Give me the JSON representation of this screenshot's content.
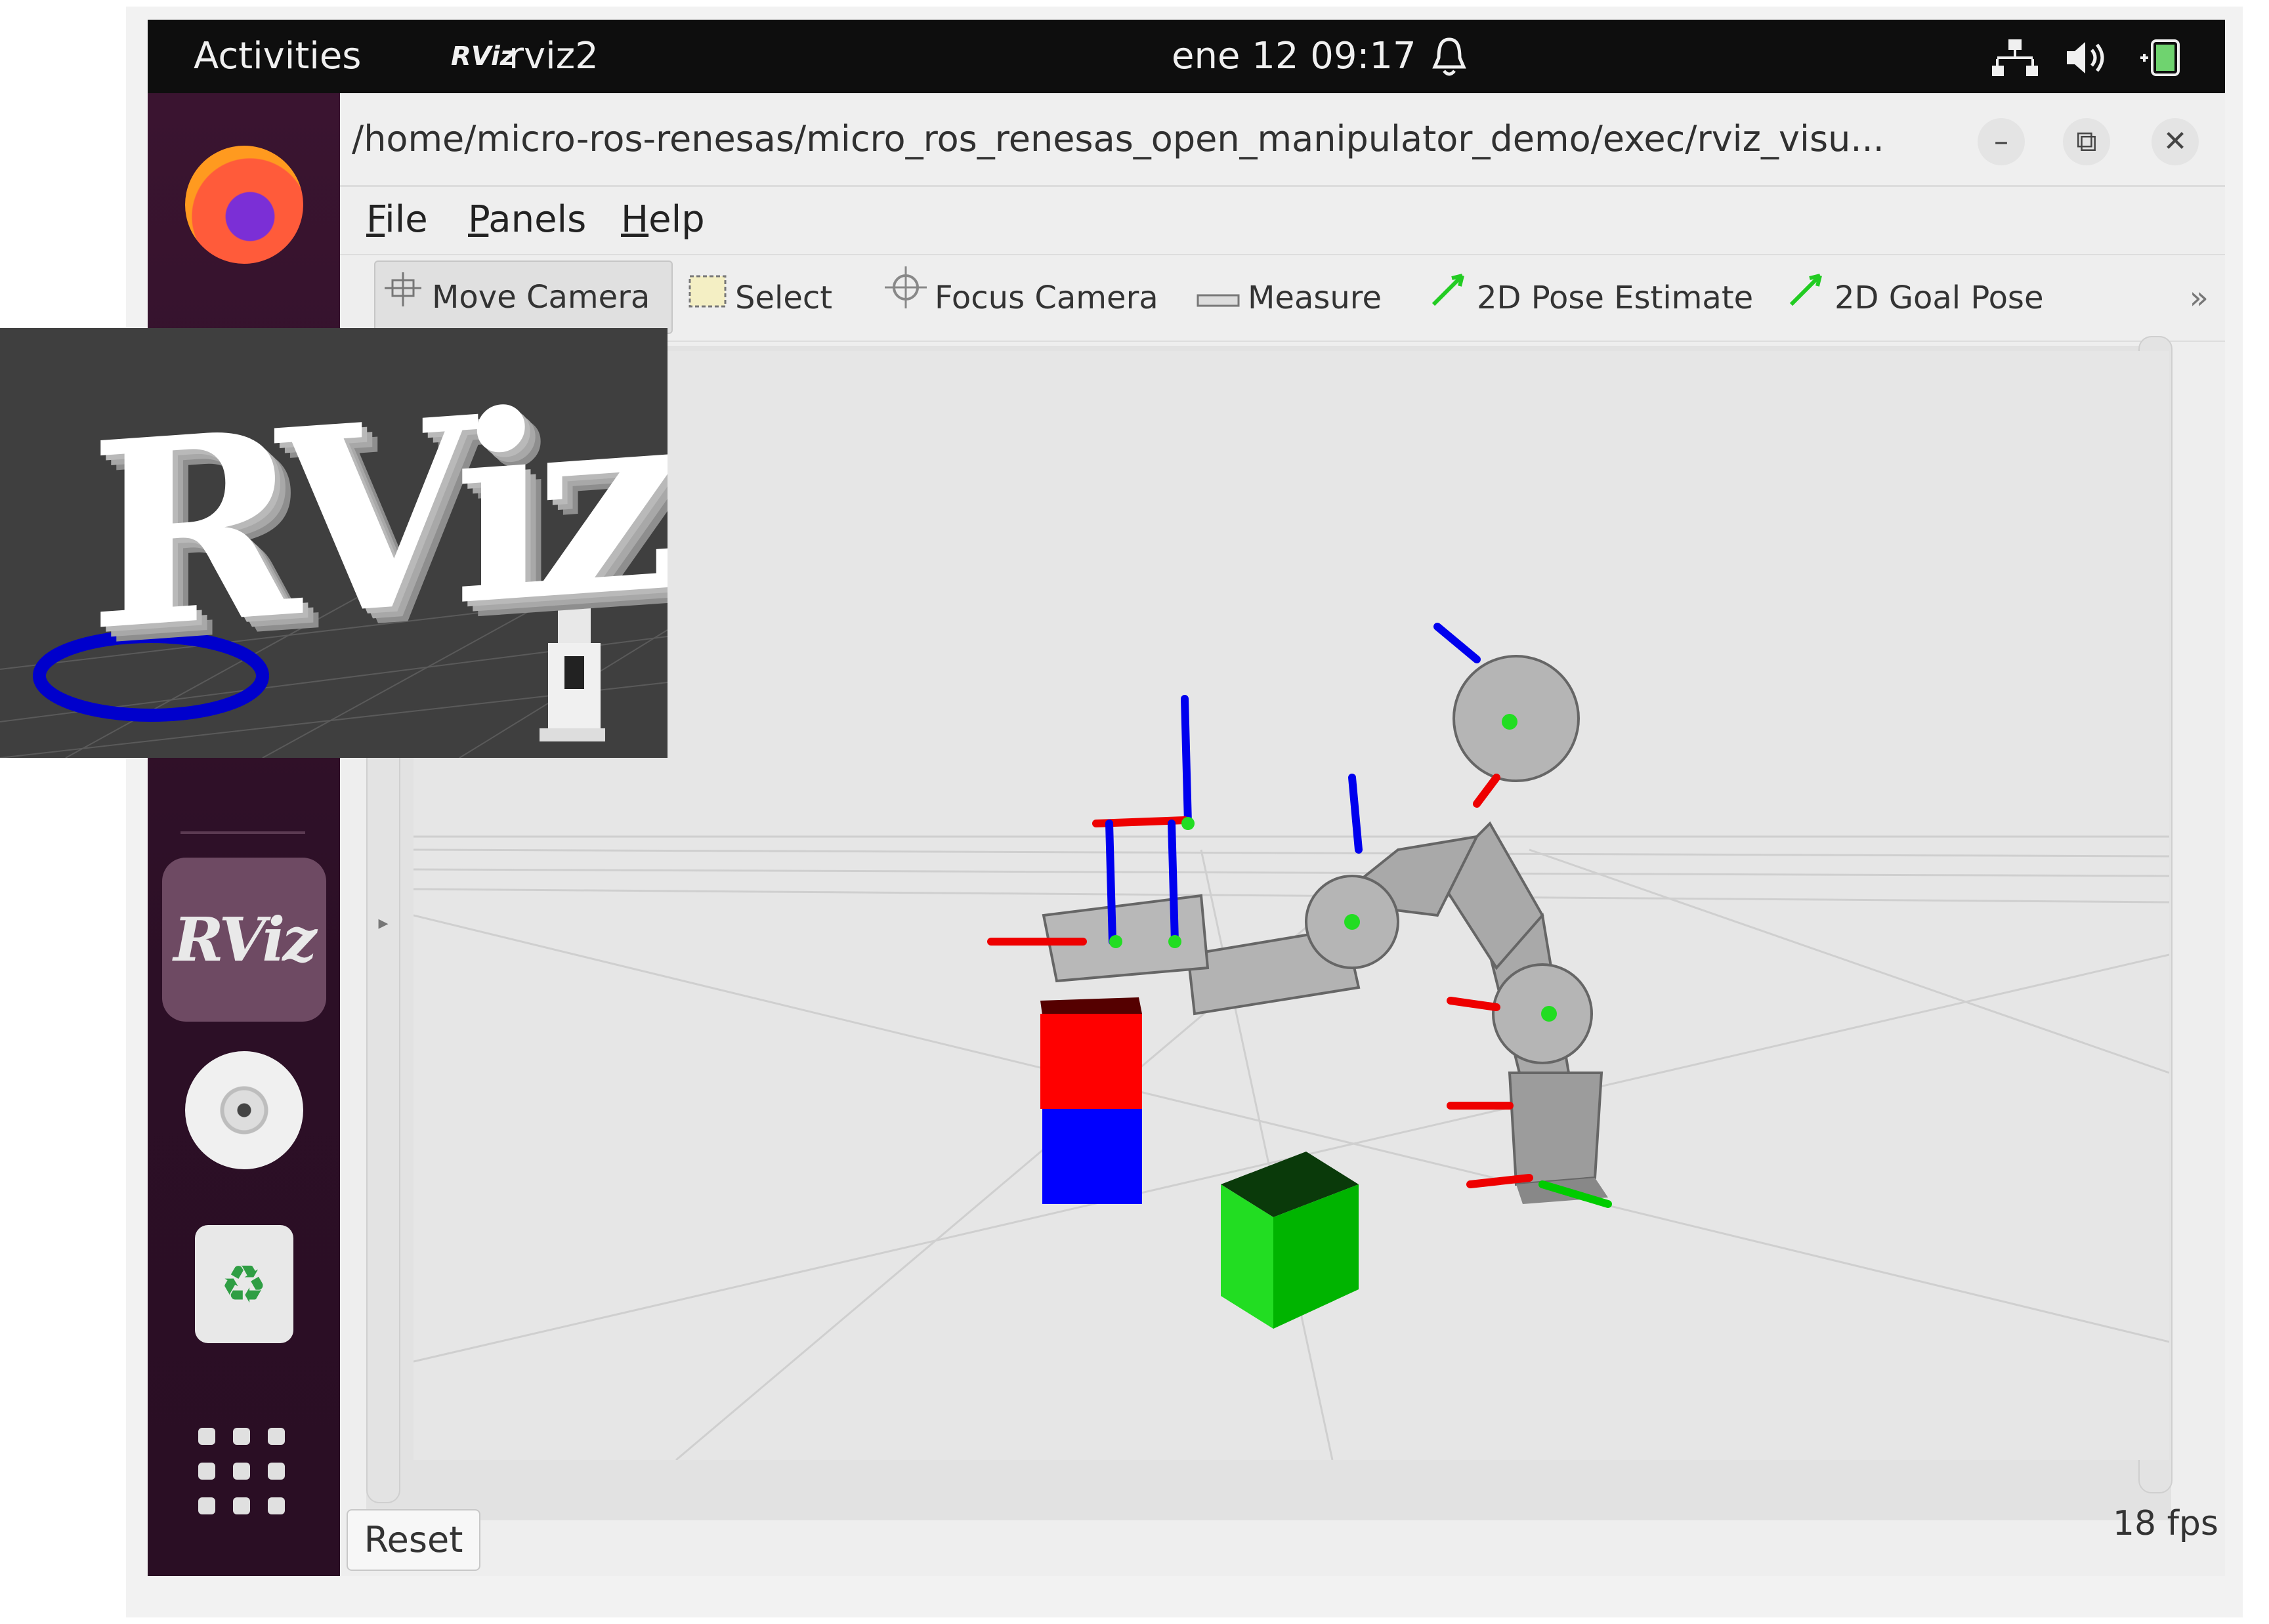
{
  "topbar": {
    "activities": "Activities",
    "app_name": "rviz2",
    "app_icon": "RViz",
    "clock": "ene 12  09:17",
    "bell_icon": "bell-icon",
    "tray_icons": [
      "network-icon",
      "volume-icon",
      "battery-icon"
    ]
  },
  "dock": {
    "items": [
      "firefox-icon",
      "rviz-icon",
      "cd-icon",
      "trash-icon",
      "app-grid-icon"
    ],
    "rviz_label": "RViz",
    "running_indicator_color": "#e95420"
  },
  "window": {
    "title": "/home/micro-ros-renesas/micro_ros_renesas_open_manipulator_demo/exec/rviz_visu...",
    "controls": {
      "minimize": "–",
      "restore": "⧉",
      "close": "✕"
    },
    "menu": [
      {
        "label": "File",
        "accel": "F"
      },
      {
        "label": "Panels",
        "accel": "P"
      },
      {
        "label": "Help",
        "accel": "H"
      }
    ],
    "toolbar": {
      "move_camera": "Move Camera",
      "select": "Select",
      "focus_camera": "Focus Camera",
      "measure": "Measure",
      "pose_estimate": "2D Pose Estimate",
      "goal_pose": "2D Goal Pose",
      "more": "»"
    },
    "reset_label": "Reset",
    "fps": "18 fps"
  },
  "scene": {
    "cubes": [
      {
        "color": "#ff0000"
      },
      {
        "color": "#0000ff"
      },
      {
        "color": "#00dd00"
      }
    ],
    "axis_colors": {
      "x": "#ff0000",
      "y": "#00dd00",
      "z": "#0000ff"
    }
  },
  "logo_card": {
    "text": "RViz"
  },
  "colors": {
    "topbar": "#0e0e0e",
    "dock": "#2c0f26",
    "accent": "#e95420"
  }
}
